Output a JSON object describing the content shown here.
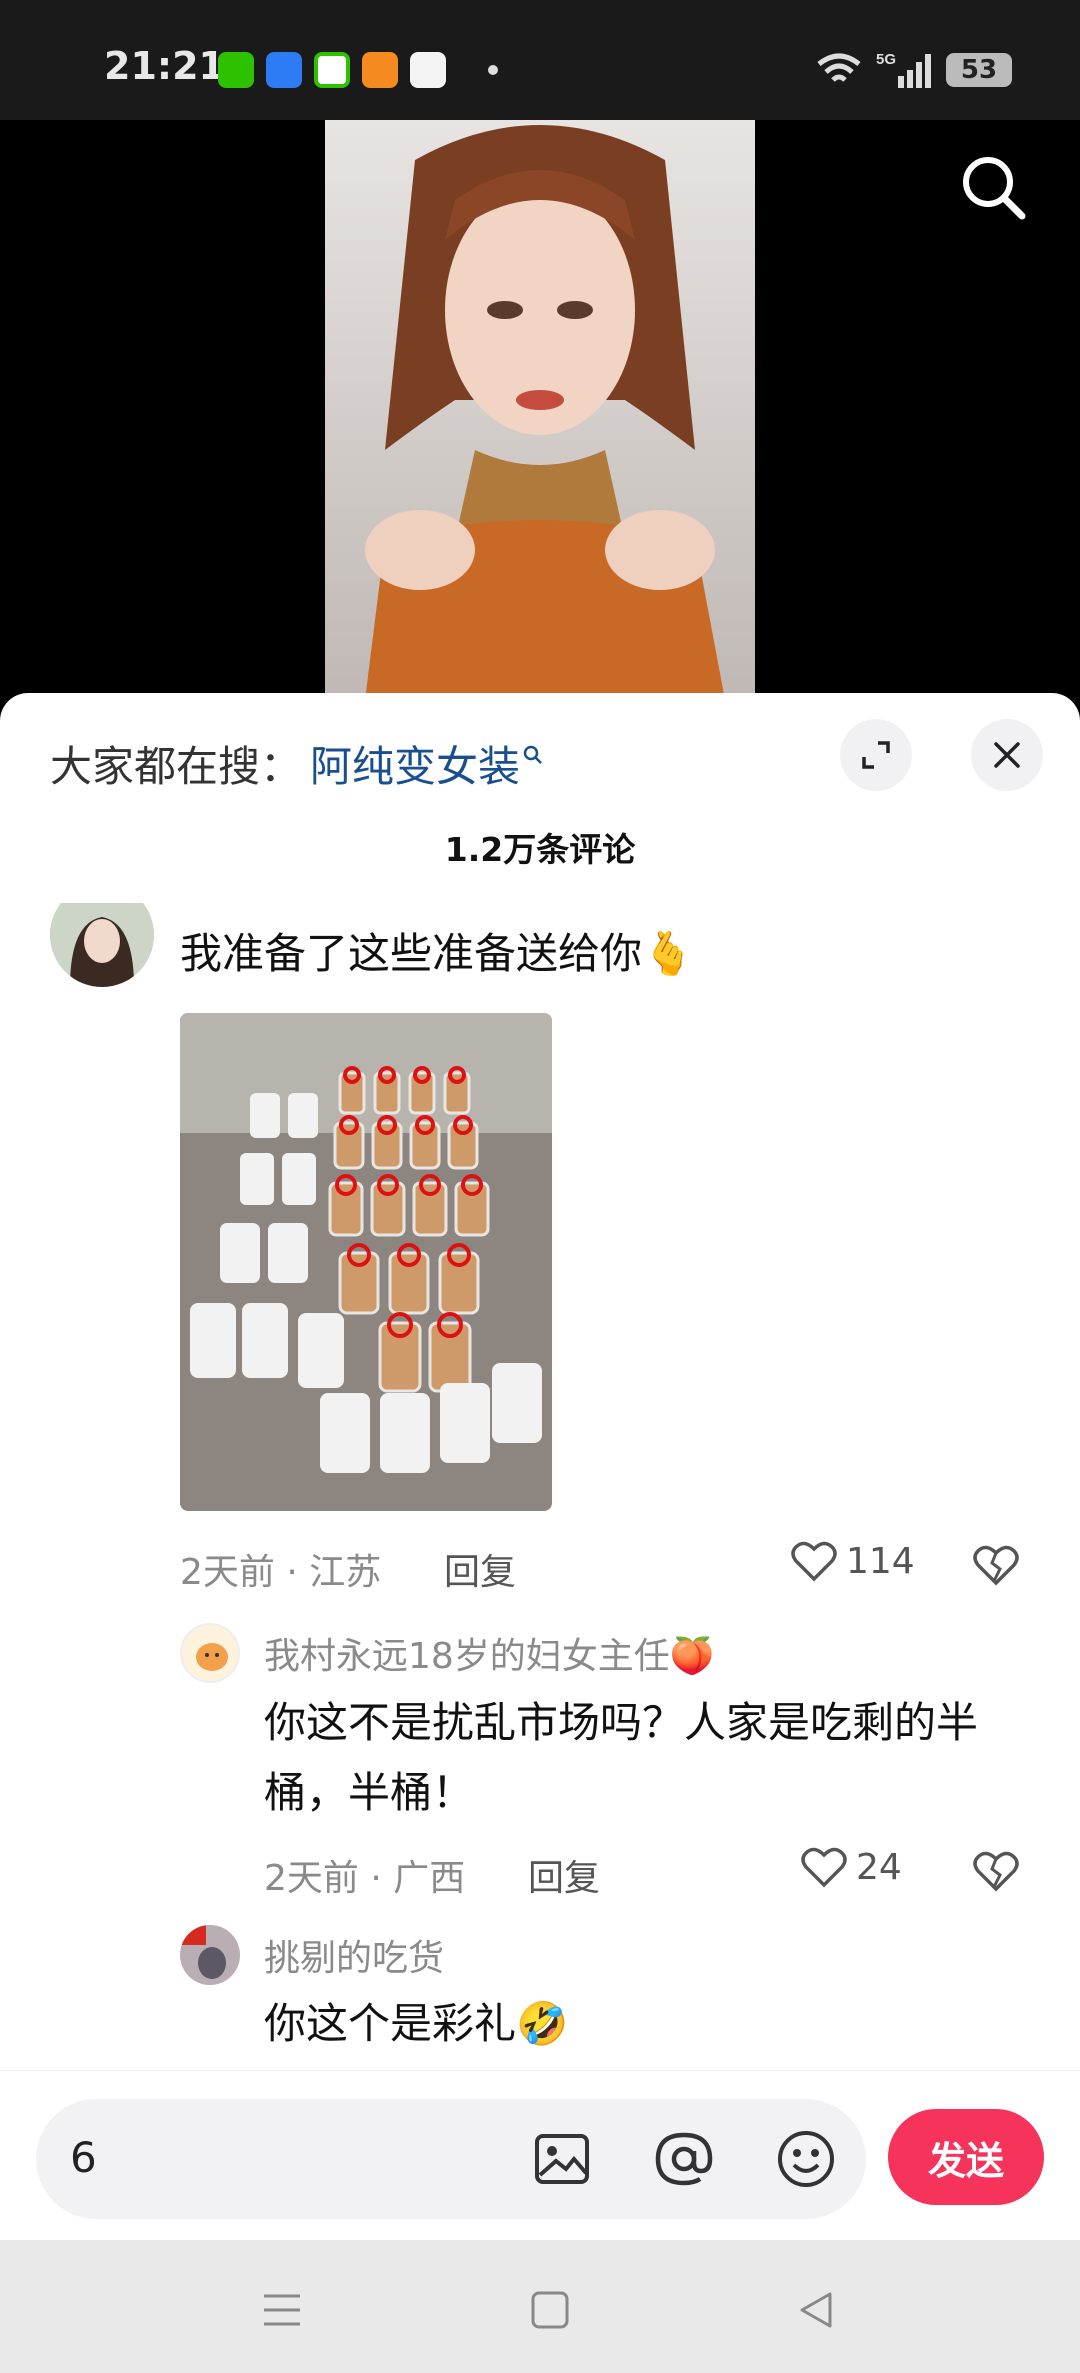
{
  "status_bar": {
    "time": "21:21",
    "network": "5G",
    "battery": "53",
    "app_icons": [
      {
        "name": "wechat-icon",
        "color": "#2dc100"
      },
      {
        "name": "feishu-icon",
        "color": "#2d7cf6"
      },
      {
        "name": "shield-icon",
        "color": "#2dc100"
      },
      {
        "name": "notes-icon",
        "color": "#f58a1f"
      },
      {
        "name": "gallery-icon",
        "color": "#f0a0c8"
      }
    ]
  },
  "trending": {
    "prefix": "大家都在搜：",
    "query": "阿纯变女装"
  },
  "comment_count": "1.2万条评论",
  "comments": [
    {
      "text": "我准备了这些准备送给你🫰",
      "time_location": "2天前 · 江苏",
      "reply_label": "回复",
      "likes": "114"
    },
    {
      "username": "我村永远18岁的妇女主任🍑",
      "text": "你这不是扰乱市场吗？人家是吃剩的半桶，半桶！",
      "time_location": "2天前 · 广西",
      "reply_label": "回复",
      "likes": "24"
    },
    {
      "username": "挑剔的吃货",
      "text": "你这个是彩礼🤣"
    }
  ],
  "input": {
    "value": "6",
    "send_label": "发送"
  },
  "colors": {
    "accent": "#f6335a",
    "link": "#1a4f8f"
  }
}
